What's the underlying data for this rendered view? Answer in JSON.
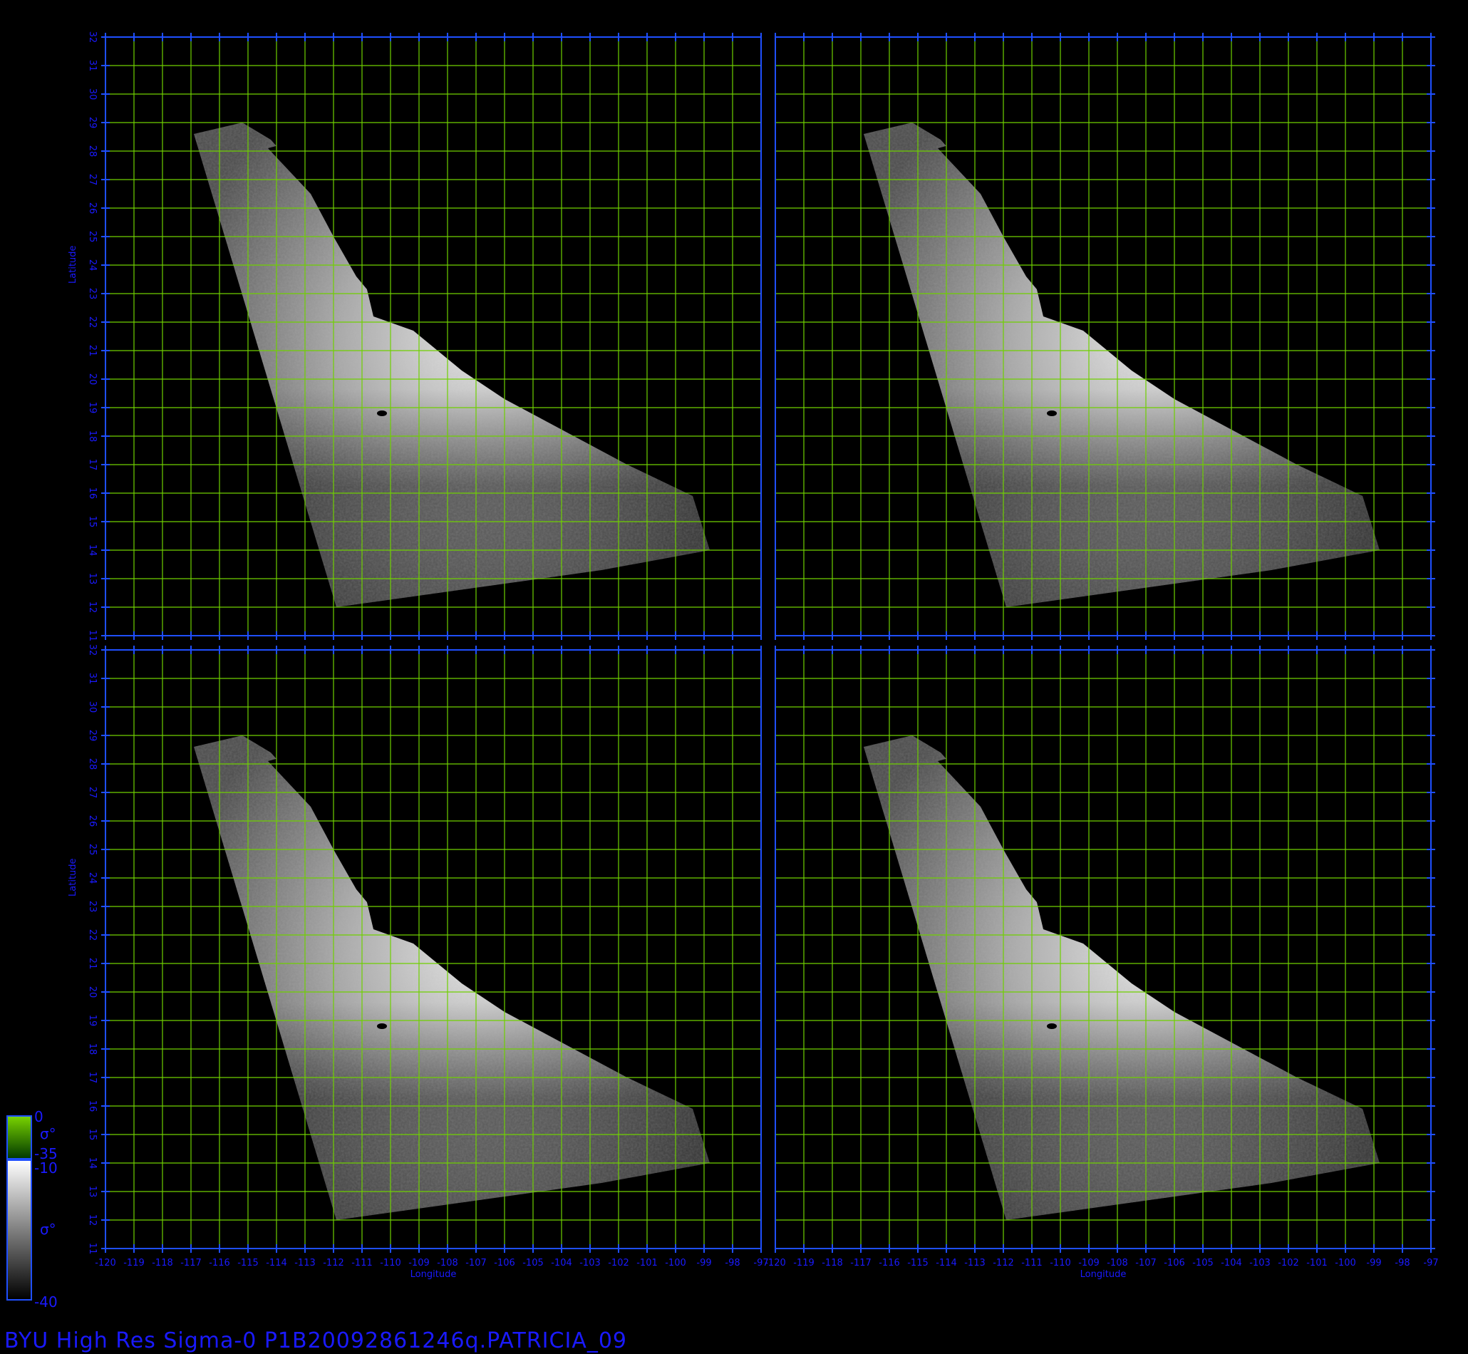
{
  "caption": "BYU  High  Res  Sigma-0  P1B20092861246q.PATRICIA_09",
  "axes": {
    "x_label": "Longitude",
    "y_label": "Latitude",
    "lon_ticks": [
      "-120",
      "-119",
      "-118",
      "-117",
      "-116",
      "-115",
      "-114",
      "-113",
      "-112",
      "-111",
      "-110",
      "-109",
      "-108",
      "-107",
      "-106",
      "-105",
      "-104",
      "-103",
      "-102",
      "-101",
      "-100",
      "-99",
      "-98",
      "-97"
    ],
    "lat_ticks": [
      "11",
      "12",
      "13",
      "14",
      "15",
      "16",
      "17",
      "18",
      "19",
      "20",
      "21",
      "22",
      "23",
      "24",
      "25",
      "26",
      "27",
      "28",
      "29",
      "30",
      "31",
      "32"
    ],
    "lon_range": [
      -120,
      -97
    ],
    "lat_range": [
      11,
      32
    ]
  },
  "panels": [
    {
      "id": "top-left"
    },
    {
      "id": "top-right"
    },
    {
      "id": "bottom-left"
    },
    {
      "id": "bottom-right"
    }
  ],
  "colorbar": {
    "land_max": "0",
    "land_min": "-35",
    "ocean_max": "-10",
    "ocean_min": "-40",
    "land_symbol": "σ°",
    "ocean_symbol": "σ°"
  },
  "colors": {
    "frame": "#1f4fff",
    "grid": "#6fd000",
    "axis_text": "#1a1aff",
    "land_colorbar_top": "#7ad400",
    "land_colorbar_bottom": "#003800"
  }
}
